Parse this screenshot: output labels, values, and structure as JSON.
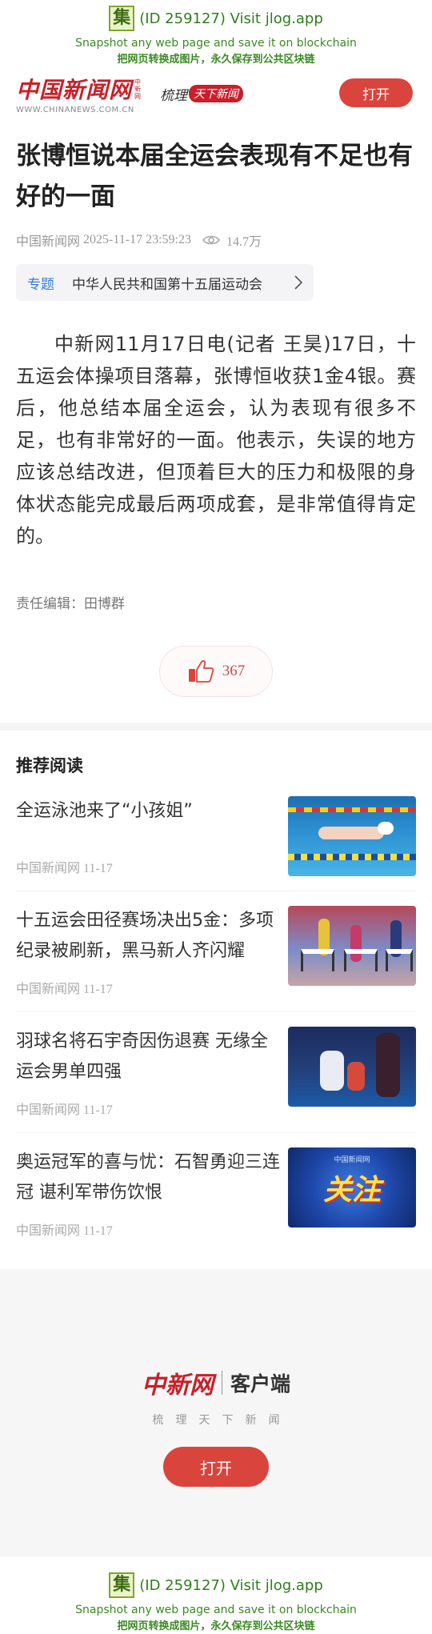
{
  "jlog": {
    "badge": "集",
    "id_text": "(ID 259127) Visit jlog.app",
    "line1": "Snapshot any web page and save it on blockchain",
    "line2": "把网页转换成图片，永久保存到公共区块链"
  },
  "header": {
    "logo_text": "中国新闻网",
    "logo_mini": "中新网",
    "logo_url": "WWW.CHINANEWS.COM.CN",
    "slogan": "梳理",
    "slogan_red": "天下新闻",
    "open_label": "打开"
  },
  "article": {
    "title": "张博恒说本届全运会表现有不足也有好的一面",
    "source": "中国新闻网",
    "datetime": "2025-11-17 23:59:23",
    "views": "14.7万",
    "topic_tag": "专题",
    "topic_name": "中华人民共和国第十五届运动会",
    "body": "中新网11月17日电(记者 王昊)17日，十五运会体操项目落幕，张博恒收获1金4银。赛后，他总结本届全运会，认为表现有很多不足，也有非常好的一面。他表示，失误的地方应该总结改进，但顶着巨大的压力和极限的身体状态能完成最后两项成套，是非常值得肯定的。",
    "editor": "责任编辑：田博群",
    "likes": "367"
  },
  "recommend": {
    "heading": "推荐阅读",
    "items": [
      {
        "title": "全运泳池来了“小孩姐”",
        "source": "中国新闻网",
        "date": "11-17",
        "thumb": "swim"
      },
      {
        "title": "十五运会田径赛场决出5金：多项纪录被刷新，黑马新人齐闪耀",
        "source": "中国新闻网",
        "date": "11-17",
        "thumb": "track"
      },
      {
        "title": "羽球名将石宇奇因伤退赛 无缘全运会男单四强",
        "source": "中国新闻网",
        "date": "11-17",
        "thumb": "badminton"
      },
      {
        "title": "奥运冠军的喜与忧：石智勇迎三连冠 谌利军带伤饮恨",
        "source": "中国新闻网",
        "date": "11-17",
        "thumb": "focus"
      }
    ]
  },
  "thumb_text": {
    "focus_label": "关注",
    "focus_logo": "中国新闻网"
  },
  "promo": {
    "logo": "中新网",
    "client": "客户端",
    "tagline": "梳理天下新闻",
    "open_label": "打开"
  },
  "colors": {
    "brand_red": "#c8202a",
    "button_red": "#d9443c",
    "link_blue": "#3a7bd5",
    "jlog_green": "#3a8a22"
  }
}
